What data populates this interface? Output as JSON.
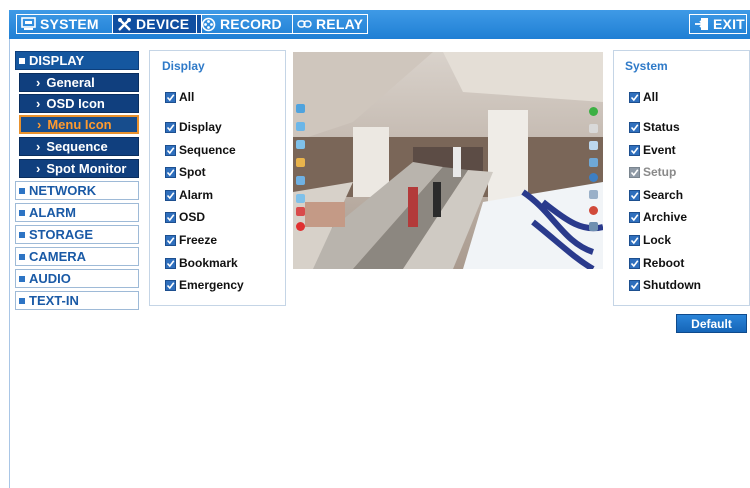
{
  "top_tabs": [
    {
      "label": "SYSTEM",
      "icon": "monitor-icon",
      "active": false
    },
    {
      "label": "DEVICE",
      "icon": "tools-icon",
      "active": true
    },
    {
      "label": "RECORD",
      "icon": "film-reel-icon",
      "active": false
    },
    {
      "label": "RELAY",
      "icon": "chain-link-icon",
      "active": false
    }
  ],
  "exit_label": "EXIT",
  "sidebar": {
    "display": "DISPLAY",
    "sub": [
      "General",
      "OSD Icon",
      "Menu Icon",
      "Sequence",
      "Spot Monitor"
    ],
    "selected_sub": "Menu Icon",
    "others": [
      "NETWORK",
      "ALARM",
      "STORAGE",
      "CAMERA",
      "AUDIO",
      "TEXT-IN"
    ]
  },
  "display_panel": {
    "title": "Display",
    "all_label": "All",
    "items": [
      "Display",
      "Sequence",
      "Spot",
      "Alarm",
      "OSD",
      "Freeze",
      "Bookmark",
      "Emergency"
    ]
  },
  "system_panel": {
    "title": "System",
    "all_label": "All",
    "items": [
      "Status",
      "Event",
      "Setup",
      "Search",
      "Archive",
      "Lock",
      "Reboot",
      "Shutdown"
    ],
    "disabled": [
      "Setup"
    ]
  },
  "default_label": "Default",
  "colors": {
    "accent": "#1f7fd4",
    "selected": "#e8912d",
    "nav_dark": "#103f7e"
  }
}
